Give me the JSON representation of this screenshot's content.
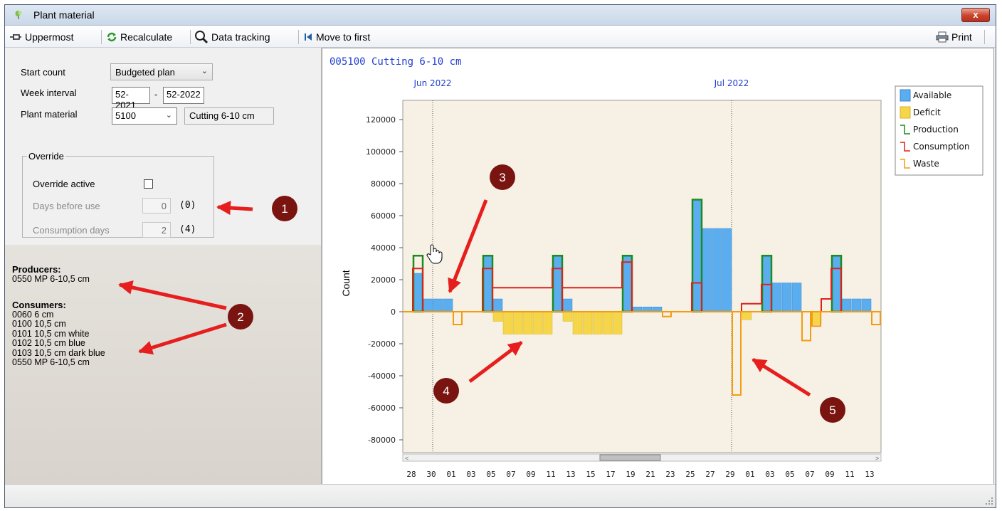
{
  "window": {
    "title": "Plant material",
    "close_label": "x"
  },
  "toolbar": {
    "uppermost": "Uppermost",
    "recalculate": "Recalculate",
    "data_tracking": "Data tracking",
    "move_first": "Move to first",
    "print": "Print"
  },
  "form": {
    "start_count_label": "Start count",
    "start_count_value": "Budgeted plan",
    "week_interval_label": "Week interval",
    "week_from": "52-2021",
    "week_sep": "-",
    "week_to": "52-2022",
    "plant_material_label": "Plant material",
    "plant_material_value": "5100",
    "plant_material_desc": "Cutting 6-10 cm"
  },
  "override": {
    "legend": "Override",
    "active_label": "Override active",
    "active_checked": false,
    "days_before_label": "Days before use",
    "days_before_value": "0",
    "days_before_default": "(0)",
    "consumption_days_label": "Consumption days",
    "consumption_days_value": "2",
    "consumption_days_default": "(4)"
  },
  "producers": {
    "heading": "Producers:",
    "items": [
      "0550 MP 6-10,5 cm"
    ]
  },
  "consumers": {
    "heading": "Consumers:",
    "items": [
      "0060 6 cm",
      "0100 10,5 cm",
      "0101 10,5 cm white",
      "0102 10,5 cm blue",
      "0103 10,5 cm dark blue",
      "0550 MP 6-10,5 cm"
    ]
  },
  "callouts": [
    "1",
    "2",
    "3",
    "4",
    "5"
  ],
  "colors": {
    "available": "#5aaef0",
    "deficit": "#f5d64a",
    "production": "#1f8a1f",
    "consumption": "#e0201c",
    "waste": "#f39c12",
    "callout": "#7a1410",
    "arrow": "#e61e1e",
    "plot_bg": "#f6f1e4"
  },
  "chart_data": {
    "type": "bar",
    "title": "005100 Cutting 6-10 cm",
    "ylabel": "Count",
    "ylim": [
      -85000,
      125000
    ],
    "yticks": [
      120000,
      100000,
      80000,
      60000,
      40000,
      20000,
      0,
      -20000,
      -40000,
      -60000,
      -80000
    ],
    "month_labels": [
      {
        "label": "Jun 2022",
        "day_index": 3
      },
      {
        "label": "Jul 2022",
        "day_index": 33
      }
    ],
    "x_tick_labels": [
      "28",
      "30",
      "01",
      "03",
      "05",
      "07",
      "09",
      "11",
      "13",
      "15",
      "17",
      "19",
      "21",
      "23",
      "25",
      "27",
      "29",
      "01",
      "03",
      "05",
      "07",
      "09",
      "11",
      "13"
    ],
    "x_day_count": 48,
    "legend": [
      "Available",
      "Deficit",
      "Production",
      "Consumption",
      "Waste"
    ],
    "legend_position": "right",
    "available_bars": [
      {
        "day": 2,
        "value": 24000
      },
      {
        "day": 3,
        "value": 8000
      },
      {
        "day": 4,
        "value": 8000
      },
      {
        "day": 5,
        "value": 8000
      },
      {
        "day": 9,
        "value": 35000
      },
      {
        "day": 10,
        "value": 8000
      },
      {
        "day": 16,
        "value": 35000
      },
      {
        "day": 17,
        "value": 8000
      },
      {
        "day": 23,
        "value": 35000
      },
      {
        "day": 24,
        "value": 3000
      },
      {
        "day": 25,
        "value": 3000
      },
      {
        "day": 26,
        "value": 3000
      },
      {
        "day": 30,
        "value": 70000
      },
      {
        "day": 31,
        "value": 52000
      },
      {
        "day": 32,
        "value": 52000
      },
      {
        "day": 33,
        "value": 52000
      },
      {
        "day": 37,
        "value": 35000
      },
      {
        "day": 38,
        "value": 18000
      },
      {
        "day": 39,
        "value": 18000
      },
      {
        "day": 40,
        "value": 18000
      },
      {
        "day": 44,
        "value": 35000
      },
      {
        "day": 45,
        "value": 8000
      },
      {
        "day": 46,
        "value": 8000
      },
      {
        "day": 47,
        "value": 8000
      }
    ],
    "deficit_bars": [
      {
        "day": 10,
        "value": -6000
      },
      {
        "day": 11,
        "value": -14000
      },
      {
        "day": 12,
        "value": -14000
      },
      {
        "day": 13,
        "value": -14000
      },
      {
        "day": 14,
        "value": -14000
      },
      {
        "day": 15,
        "value": -14000
      },
      {
        "day": 17,
        "value": -6000
      },
      {
        "day": 18,
        "value": -14000
      },
      {
        "day": 19,
        "value": -14000
      },
      {
        "day": 20,
        "value": -14000
      },
      {
        "day": 21,
        "value": -14000
      },
      {
        "day": 22,
        "value": -14000
      },
      {
        "day": 35,
        "value": -5000
      },
      {
        "day": 42,
        "value": -8000
      }
    ],
    "production_bars": [
      {
        "day": 2,
        "value": 35000
      },
      {
        "day": 9,
        "value": 35000
      },
      {
        "day": 16,
        "value": 35000
      },
      {
        "day": 23,
        "value": 35000
      },
      {
        "day": 30,
        "value": 70000
      },
      {
        "day": 37,
        "value": 35000
      },
      {
        "day": 44,
        "value": 35000
      }
    ],
    "consumption_steps": [
      {
        "day": 2,
        "value": 27000
      },
      {
        "day": 9,
        "value": 27000
      },
      {
        "day": 10,
        "value": 15000
      },
      {
        "day": 16,
        "value": 27000
      },
      {
        "day": 17,
        "value": 15000
      },
      {
        "day": 23,
        "value": 31000
      },
      {
        "day": 30,
        "value": 18000
      },
      {
        "day": 35,
        "value": 5000
      },
      {
        "day": 37,
        "value": 17000
      },
      {
        "day": 43,
        "value": 8000
      },
      {
        "day": 44,
        "value": 27000
      }
    ],
    "waste_bars": [
      {
        "day": 6,
        "value": -8000
      },
      {
        "day": 27,
        "value": -3000
      },
      {
        "day": 34,
        "value": -52000
      },
      {
        "day": 41,
        "value": -18000
      },
      {
        "day": 42,
        "value": -9000
      },
      {
        "day": 48,
        "value": -8000
      }
    ]
  }
}
